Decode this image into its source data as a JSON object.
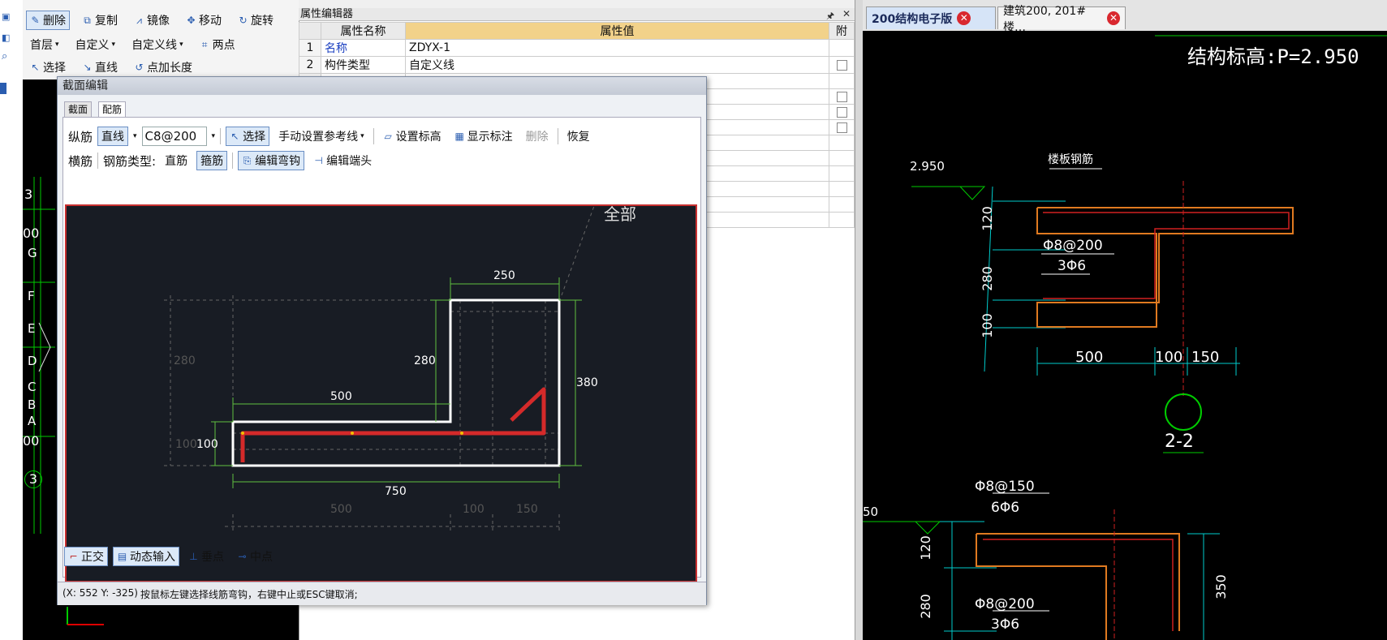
{
  "toolbar": {
    "row1": {
      "delete": "删除",
      "copy": "复制",
      "mirror": "镜像",
      "move": "移动",
      "rotate": "旋转"
    },
    "row2": {
      "floor": "首层",
      "custom1": "自定义",
      "custom2": "自定义线",
      "two_points": "两点"
    },
    "row3": {
      "select": "选择",
      "line": "直线",
      "point_length": "点加长度"
    }
  },
  "left_canvas": {
    "labels": [
      "3",
      "00",
      "G",
      "F",
      "E",
      "D",
      "C",
      "B",
      "A",
      "00",
      "3"
    ]
  },
  "property_editor": {
    "title": "属性编辑器",
    "headers": {
      "name": "属性名称",
      "value": "属性值",
      "attach": "附"
    },
    "rows": [
      {
        "num": "1",
        "name": "名称",
        "value": "ZDYX-1",
        "checkbox": false
      },
      {
        "num": "2",
        "name": "构件类型",
        "value": "自定义线",
        "checkbox": true
      },
      {
        "num": "",
        "name": "",
        "value": "",
        "checkbox": false
      },
      {
        "num": "",
        "name": "",
        "value": "",
        "checkbox": true
      },
      {
        "num": "",
        "name": "",
        "value": "",
        "checkbox": true
      },
      {
        "num": "",
        "name": "",
        "value": "",
        "checkbox": true
      },
      {
        "num": "",
        "name": "",
        "value": "",
        "checkbox": false
      },
      {
        "num": "",
        "name": "",
        "value": "",
        "checkbox": false
      },
      {
        "num": "",
        "name": "",
        "value": "",
        "checkbox": false
      },
      {
        "num": "",
        "name": "",
        "value": "",
        "checkbox": false
      },
      {
        "num": "",
        "name": "",
        "value": "",
        "checkbox": false
      },
      {
        "num": "",
        "name": "",
        "value": "",
        "checkbox": false
      }
    ]
  },
  "doc_tabs": [
    {
      "label": "200结构电子版",
      "active": true
    },
    {
      "label": "建筑200, 201#楼…",
      "active": false
    }
  ],
  "dialog": {
    "title": "截面编辑",
    "tabs": [
      "截面",
      "配筋"
    ],
    "row1": {
      "longitudinal": "纵筋",
      "line": "直线",
      "spec": "C8@200",
      "select": "选择",
      "manual_ref": "手动设置参考线",
      "set_elev": "设置标高",
      "show_dim": "显示标注",
      "delete": "删除",
      "restore": "恢复"
    },
    "row2": {
      "transverse": "横筋",
      "bar_type": "钢筋类型:",
      "straight": "直筋",
      "stirrup": "箍筋",
      "edit_hook": "编辑弯钩",
      "edit_end": "编辑端头"
    },
    "drawing": {
      "dim_250": "250",
      "dim_280_inner": "280",
      "dim_280_ghost": "280",
      "dim_380": "380",
      "dim_500_top": "500",
      "dim_100_left": "100",
      "dim_100_ghost": "100",
      "dim_750": "750",
      "dim_500_ghost": "500",
      "dim_100_bottom_ghost": "100",
      "dim_150_ghost": "150",
      "corner_text": "全部"
    },
    "bottom": {
      "ortho": "正交",
      "dynamic_input": "动态输入",
      "perpendicular": "垂点",
      "midpoint": "中点"
    },
    "status": {
      "coords": "(X: 552 Y: -325)",
      "message": "按鼠标左键选择线筋弯钩，右键中止或ESC键取消;"
    }
  },
  "right_drawing": {
    "elevation": "结构标高:P=2.950",
    "level": "2.950",
    "slab_rebar": "楼板钢筋",
    "rebar1": "Φ8@200",
    "rebar1_sub": "3Φ6",
    "dims_v": [
      "120",
      "280",
      "100"
    ],
    "dims_h": [
      "500",
      "100",
      "150"
    ],
    "section": "2-2",
    "rebar2": "Φ8@150",
    "rebar2_sub": "6Φ6",
    "rebar3": "Φ8@200",
    "rebar3_sub": "3Φ6",
    "dims_v2": [
      "120",
      "280"
    ],
    "dim_350": "350",
    "level_partial": "50"
  }
}
